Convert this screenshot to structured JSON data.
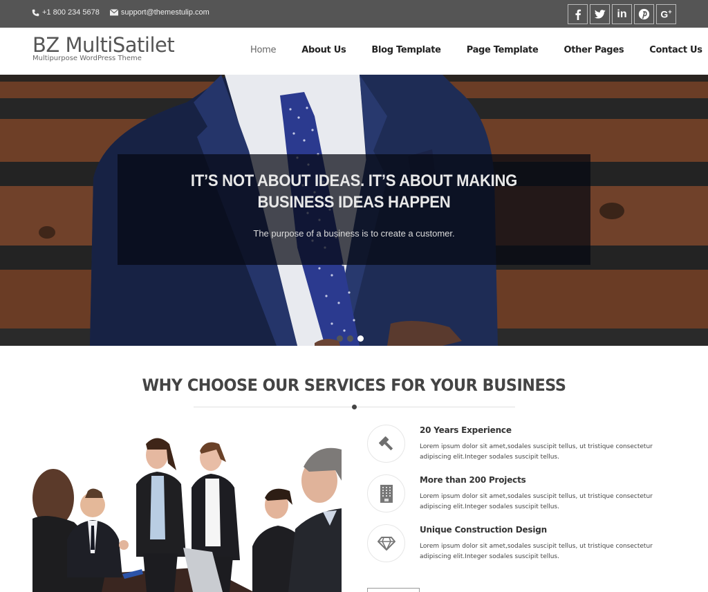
{
  "topbar": {
    "phone": "+1 800 234 5678",
    "email": "support@themestulip.com",
    "phone_icon": "phone-icon",
    "email_icon": "envelope-icon",
    "socials": [
      {
        "name": "facebook-icon",
        "glyph": "f"
      },
      {
        "name": "twitter-icon",
        "glyph": "t"
      },
      {
        "name": "linkedin-icon",
        "glyph": "in"
      },
      {
        "name": "pinterest-icon",
        "glyph": "p"
      },
      {
        "name": "google-plus-icon",
        "glyph": "G+"
      }
    ]
  },
  "header": {
    "site_title": "BZ MultiSatilet",
    "tagline": "Multipurpose WordPress Theme",
    "nav": [
      {
        "label": "Home",
        "active": true
      },
      {
        "label": "About Us"
      },
      {
        "label": "Blog Template"
      },
      {
        "label": "Page Template"
      },
      {
        "label": "Other Pages"
      },
      {
        "label": "Contact Us"
      }
    ]
  },
  "hero": {
    "title": "IT’S NOT ABOUT IDEAS. IT’S ABOUT MAKING BUSINESS IDEAS HAPPEN",
    "subtitle": "The purpose of a business is to create a customer.",
    "slides_total": 3,
    "active_slide": 3
  },
  "services": {
    "heading": "WHY CHOOSE OUR SERVICES FOR YOUR BUSINESS",
    "image_alt": "Business team meeting",
    "items": [
      {
        "icon": "gavel-icon",
        "title": "20 Years Experience",
        "text": "Lorem ipsum dolor sit amet,sodales suscipit tellus, ut tristique consectetur adipiscing elit.Integer sodales suscipit tellus."
      },
      {
        "icon": "building-icon",
        "title": "More than 200 Projects",
        "text": "Lorem ipsum dolor sit amet,sodales suscipit tellus, ut tristique consectetur adipiscing elit.Integer sodales suscipit tellus."
      },
      {
        "icon": "diamond-icon",
        "title": "Unique Construction Design",
        "text": "Lorem ipsum dolor sit amet,sodales suscipit tellus, ut tristique consectetur adipiscing elit.Integer sodales suscipit tellus."
      }
    ]
  },
  "colors": {
    "topbar_bg": "#555555",
    "text_dark": "#333333",
    "caption_overlay": "#05080f"
  }
}
